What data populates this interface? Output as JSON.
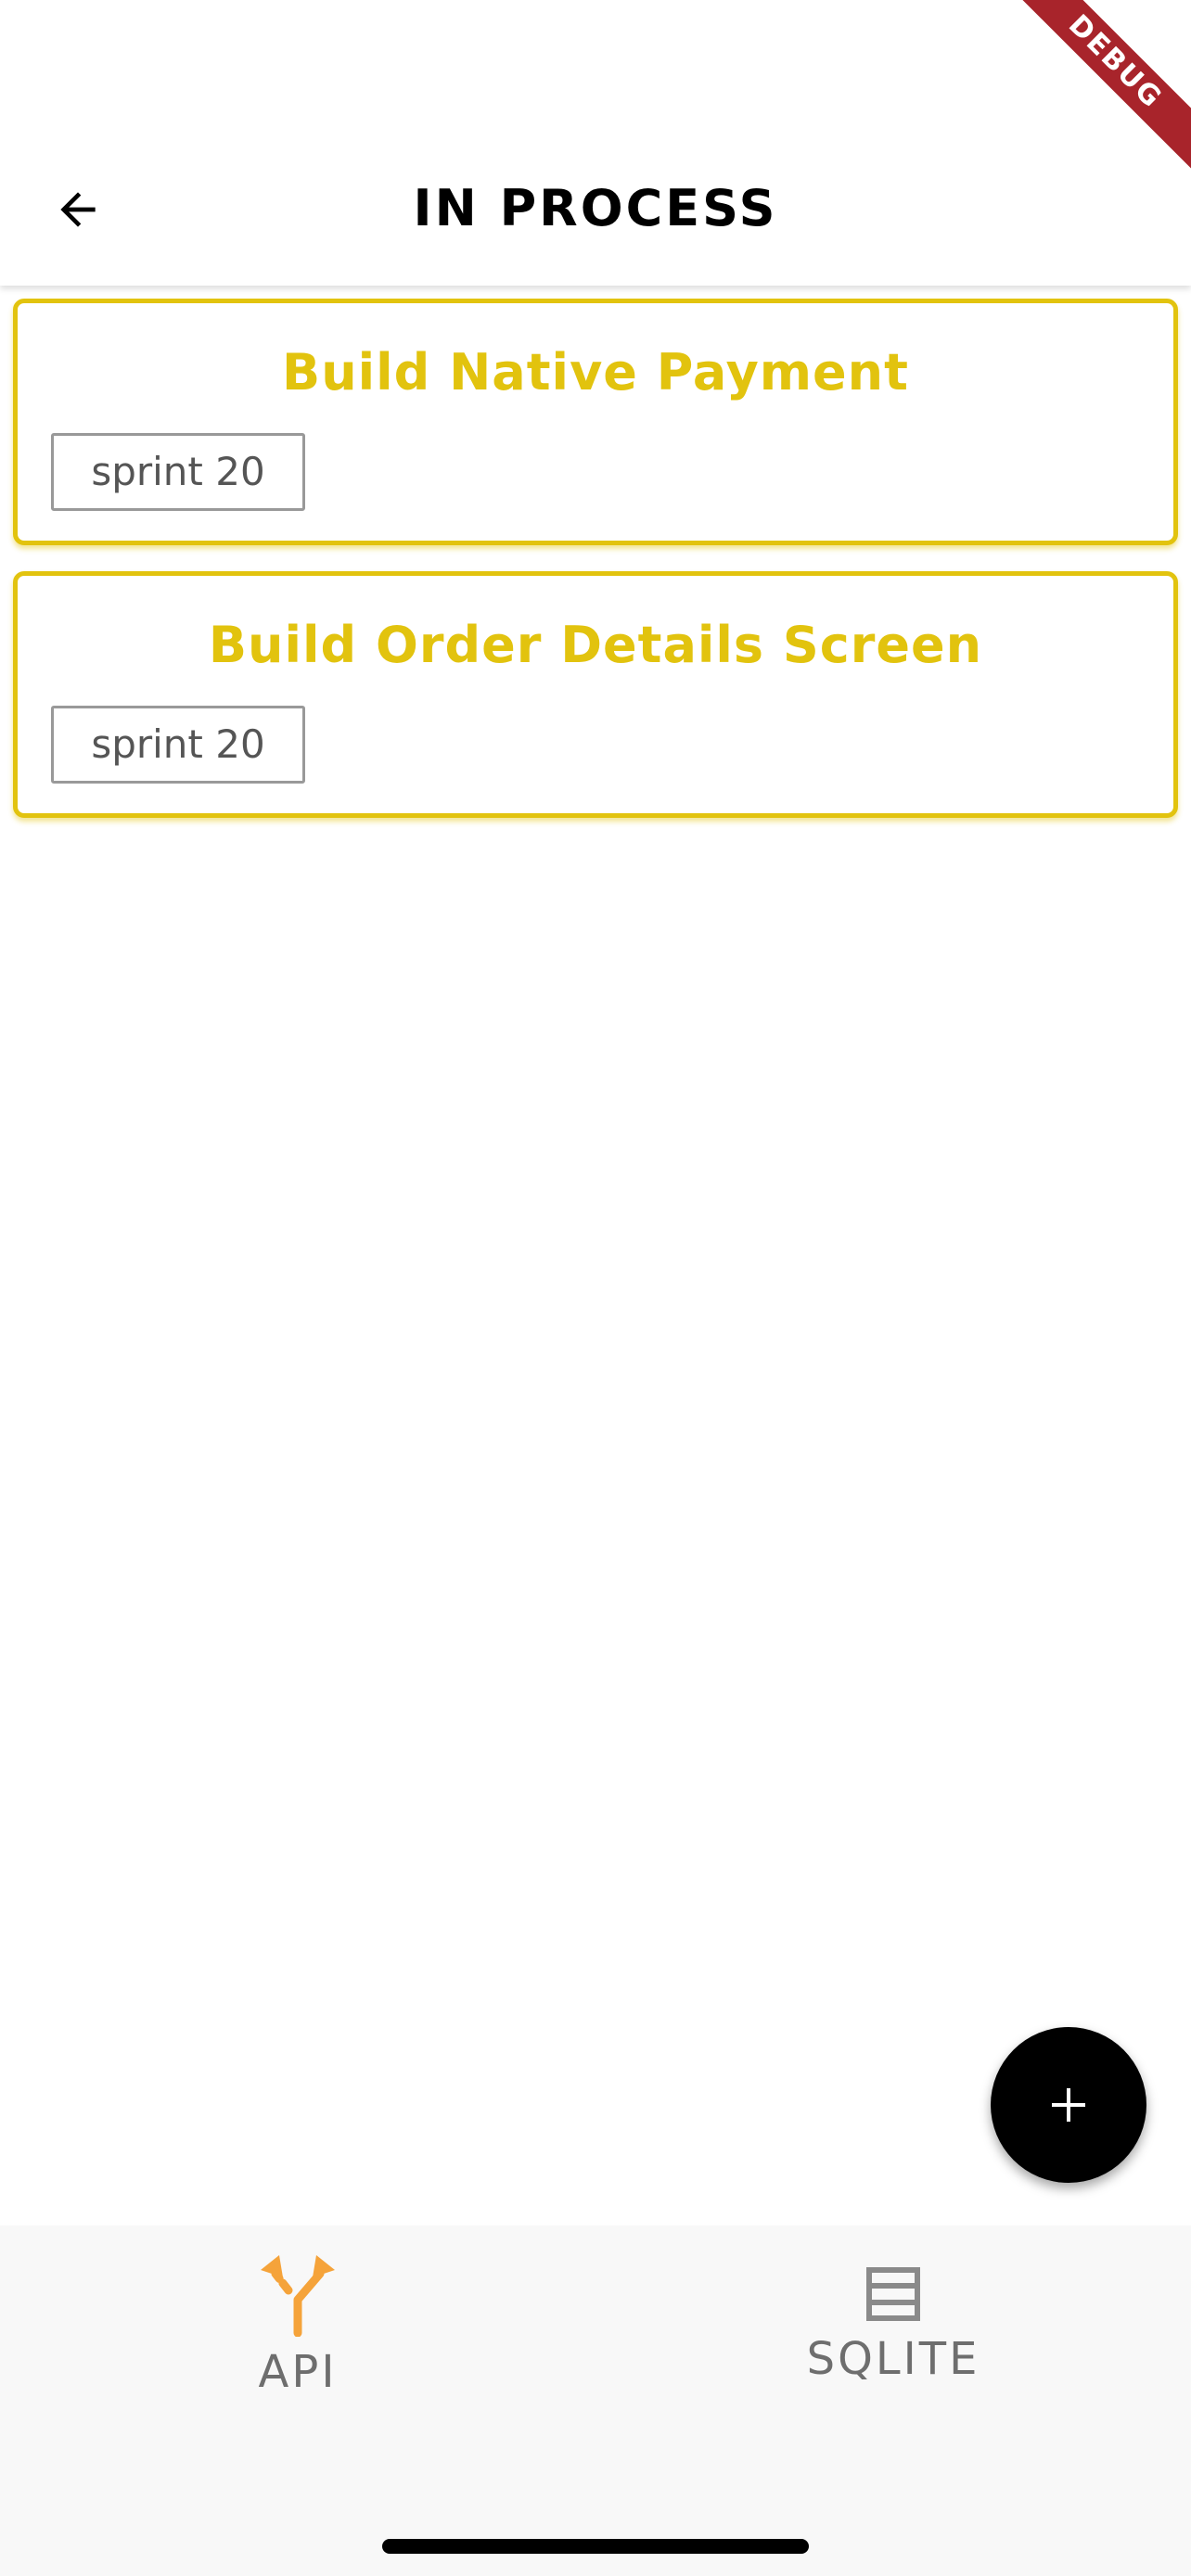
{
  "debug_banner": {
    "label": "DEBUG"
  },
  "appbar": {
    "title": "IN PROCESS",
    "back_icon": "arrow-left-icon"
  },
  "tasks": [
    {
      "title": "Build Native Payment",
      "tag": "sprint 20"
    },
    {
      "title": "Build Order Details Screen",
      "tag": "sprint 20"
    }
  ],
  "fab": {
    "icon": "plus-icon"
  },
  "bottom_nav": {
    "items": [
      {
        "label": "API",
        "icon": "merge-arrows-icon",
        "active": true
      },
      {
        "label": "SQLITE",
        "icon": "database-table-icon",
        "active": false
      }
    ]
  },
  "colors": {
    "accent": "#e2c30e",
    "active_nav_icon": "#f5a33a",
    "inactive": "#6e6e6e",
    "debug_banner": "#a8242b"
  }
}
